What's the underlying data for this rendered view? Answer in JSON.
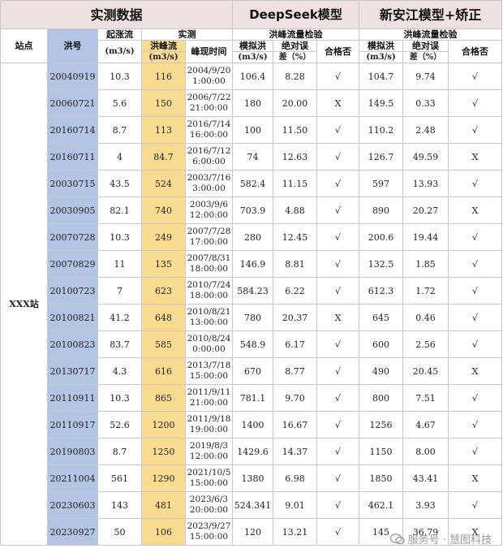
{
  "header": {
    "measured_group": "实测数据",
    "deepseek_group": "DeepSeek模型",
    "xaj_group": "新安江模型+矫正",
    "station_label": "站点",
    "flood_id_label": "洪号",
    "base_flow_label": "起涨流",
    "base_flow_unit": "(m3/s)",
    "measured_label": "实测",
    "peak_flow_label": "洪峰流",
    "peak_flow_unit": "(m3/s)",
    "peak_time_label": "峰现时间",
    "check_label_ds": "洪峰流量检验",
    "check_label_xaj": "洪峰流量检验",
    "sim_label": "模拟洪",
    "sim_unit": "(m3/s)",
    "err_label": "绝对误",
    "err_unit": "差（%）",
    "pass_label": "合格否"
  },
  "station_name": "XXX站",
  "rows": [
    {
      "id": "20040919",
      "base": "10.3",
      "peak": "116",
      "date": "2004/9/20",
      "time": "1:00:00",
      "ds_sim": "106.4",
      "ds_err": "8.28",
      "ds_pass": "√",
      "x_sim": "104.7",
      "x_err": "9.74",
      "x_pass": "√"
    },
    {
      "id": "20060721",
      "base": "5.6",
      "peak": "150",
      "date": "2006/7/22",
      "time": "21:00:00",
      "ds_sim": "180",
      "ds_err": "20.00",
      "ds_pass": "X",
      "x_sim": "149.5",
      "x_err": "0.33",
      "x_pass": "√"
    },
    {
      "id": "20160714",
      "base": "8.7",
      "peak": "113",
      "date": "2016/7/14",
      "time": "16:00:00",
      "ds_sim": "100",
      "ds_err": "11.50",
      "ds_pass": "√",
      "x_sim": "110.2",
      "x_err": "2.48",
      "x_pass": "√"
    },
    {
      "id": "20160711",
      "base": "4",
      "peak": "84.7",
      "date": "2016/7/12",
      "time": "6:00:00",
      "ds_sim": "74",
      "ds_err": "12.63",
      "ds_pass": "√",
      "x_sim": "126.7",
      "x_err": "49.59",
      "x_pass": "X"
    },
    {
      "id": "20030715",
      "base": "43.5",
      "peak": "524",
      "date": "2003/7/16",
      "time": "3:00:00",
      "ds_sim": "582.4",
      "ds_err": "11.15",
      "ds_pass": "√",
      "x_sim": "597",
      "x_err": "13.93",
      "x_pass": "√"
    },
    {
      "id": "20030905",
      "base": "82.1",
      "peak": "740",
      "date": "2003/9/6",
      "time": "12:00:00",
      "ds_sim": "703.9",
      "ds_err": "4.88",
      "ds_pass": "√",
      "x_sim": "890",
      "x_err": "20.27",
      "x_pass": "X"
    },
    {
      "id": "20070728",
      "base": "10.3",
      "peak": "249",
      "date": "2007/7/28",
      "time": "17:00:00",
      "ds_sim": "280",
      "ds_err": "12.45",
      "ds_pass": "√",
      "x_sim": "200.6",
      "x_err": "19.44",
      "x_pass": "√"
    },
    {
      "id": "20070829",
      "base": "11",
      "peak": "135",
      "date": "2007/8/31",
      "time": "18:00:00",
      "ds_sim": "146.9",
      "ds_err": "8.81",
      "ds_pass": "√",
      "x_sim": "132.5",
      "x_err": "1.85",
      "x_pass": "√"
    },
    {
      "id": "20100723",
      "base": "7",
      "peak": "623",
      "date": "2010/7/24",
      "time": "18:00:00",
      "ds_sim": "584.23",
      "ds_err": "6.22",
      "ds_pass": "√",
      "x_sim": "612.3",
      "x_err": "1.72",
      "x_pass": "√"
    },
    {
      "id": "20100821",
      "base": "41.2",
      "peak": "648",
      "date": "2010/8/21",
      "time": "13:00:00",
      "ds_sim": "780",
      "ds_err": "20.37",
      "ds_pass": "X",
      "x_sim": "645",
      "x_err": "0.46",
      "x_pass": "√"
    },
    {
      "id": "20100823",
      "base": "83.7",
      "peak": "585",
      "date": "2010/8/24",
      "time": "0:00:00",
      "ds_sim": "548.9",
      "ds_err": "6.17",
      "ds_pass": "√",
      "x_sim": "600",
      "x_err": "2.56",
      "x_pass": "√"
    },
    {
      "id": "20130717",
      "base": "4.3",
      "peak": "616",
      "date": "2013/7/18",
      "time": "15:00:00",
      "ds_sim": "670",
      "ds_err": "8.77",
      "ds_pass": "√",
      "x_sim": "490",
      "x_err": "20.45",
      "x_pass": "X"
    },
    {
      "id": "20110911",
      "base": "10.3",
      "peak": "865",
      "date": "2011/9/11",
      "time": "21:00:00",
      "ds_sim": "781.1",
      "ds_err": "9.70",
      "ds_pass": "√",
      "x_sim": "800",
      "x_err": "7.51",
      "x_pass": "√"
    },
    {
      "id": "20110917",
      "base": "52.6",
      "peak": "1200",
      "date": "2011/9/18",
      "time": "19:00:00",
      "ds_sim": "1400",
      "ds_err": "16.67",
      "ds_pass": "√",
      "x_sim": "1256",
      "x_err": "4.67",
      "x_pass": "√"
    },
    {
      "id": "20190803",
      "base": "8.7",
      "peak": "1250",
      "date": "2019/8/3",
      "time": "12:00:00",
      "ds_sim": "1429.6",
      "ds_err": "14.37",
      "ds_pass": "√",
      "x_sim": "1150",
      "x_err": "8.00",
      "x_pass": "√"
    },
    {
      "id": "20211004",
      "base": "561",
      "peak": "1290",
      "date": "2021/10/5",
      "time": "15:00:00",
      "ds_sim": "1380",
      "ds_err": "6.98",
      "ds_pass": "√",
      "x_sim": "1850",
      "x_err": "43.41",
      "x_pass": "X"
    },
    {
      "id": "20230603",
      "base": "143",
      "peak": "481",
      "date": "2023/6/3",
      "time": "20:00:00",
      "ds_sim": "524.341",
      "ds_err": "9.01",
      "ds_pass": "√",
      "x_sim": "462.1",
      "x_err": "3.93",
      "x_pass": "√"
    },
    {
      "id": "20230927",
      "base": "50",
      "peak": "106",
      "date": "2023/9/27",
      "time": "15:00:00",
      "ds_sim": "120",
      "ds_err": "13.21",
      "ds_pass": "√",
      "x_sim": "145",
      "x_err": "36.79",
      "x_pass": "X"
    }
  ],
  "watermark": "服务号 · 慧图科技",
  "colors": {
    "group_header": "#efe1e1",
    "flood_id_col": "#b4c4e4",
    "peak_col": "#f9dc92",
    "grid": "#c8c8c8"
  }
}
